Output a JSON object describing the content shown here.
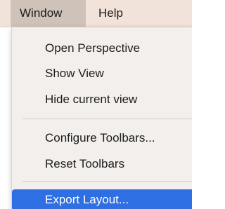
{
  "menubar": {
    "items": [
      {
        "label": "Window"
      },
      {
        "label": "Help"
      }
    ]
  },
  "menu": {
    "items": [
      {
        "label": "Open Perspective"
      },
      {
        "label": "Show View"
      },
      {
        "label": "Hide current view"
      },
      {
        "label": "Configure Toolbars..."
      },
      {
        "label": "Reset Toolbars"
      },
      {
        "label": "Export Layout..."
      }
    ]
  },
  "colors": {
    "menubar_bg": "#f2e3da",
    "active_menubar_item": "#cfc2b8",
    "menu_bg": "#f2efec",
    "highlight": "#2f6fe4"
  }
}
